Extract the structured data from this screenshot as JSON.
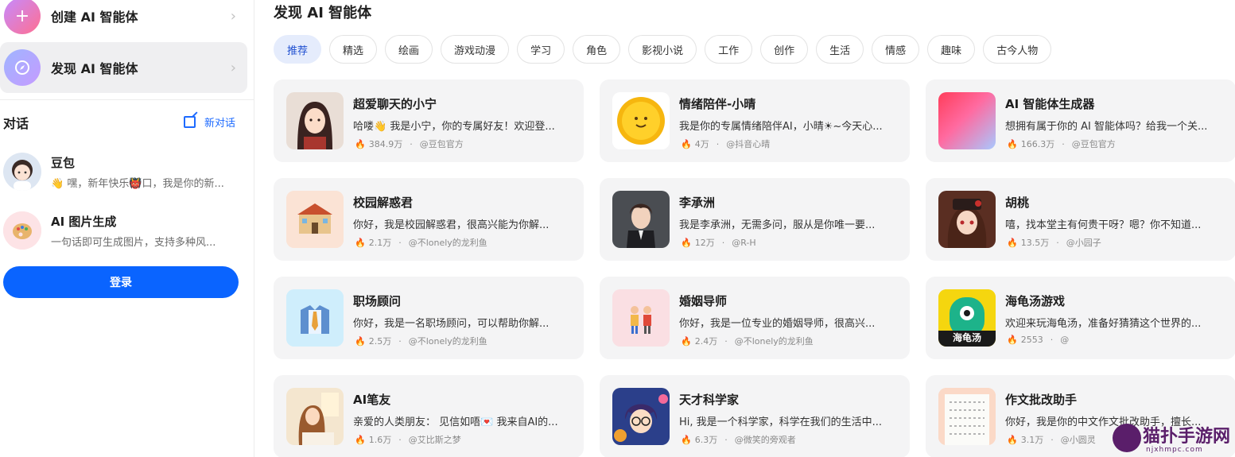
{
  "sidebar": {
    "create": {
      "label": "创建 AI 智能体",
      "icon": "plus-icon"
    },
    "discover": {
      "label": "发现 AI 智能体",
      "icon": "compass-icon"
    },
    "conversation_title": "对话",
    "new_conversation": "新对话",
    "chats": [
      {
        "name": "豆包",
        "preview": "👋 嘿，新年快乐👹口，我是你的新..."
      },
      {
        "name": "AI 图片生成",
        "preview": "一句话即可生成图片，支持多种风..."
      }
    ],
    "login_label": "登录"
  },
  "main": {
    "title": "发现 AI 智能体",
    "tabs": [
      "推荐",
      "精选",
      "绘画",
      "游戏动漫",
      "学习",
      "角色",
      "影视小说",
      "工作",
      "创作",
      "生活",
      "情感",
      "趣味",
      "古今人物"
    ],
    "active_tab": "推荐",
    "cards": [
      {
        "title": "超爱聊天的小宁",
        "desc": "哈喽👋 我是小宁，你的专属好友！欢迎登...",
        "count": "384.9万",
        "author": "@豆包官方"
      },
      {
        "title": "情绪陪伴-小晴",
        "desc": "我是你的专属情绪陪伴AI，小晴☀~今天心...",
        "count": "4万",
        "author": "@抖音心晴"
      },
      {
        "title": "AI 智能体生成器",
        "desc": "想拥有属于你的 AI 智能体吗？给我一个关...",
        "count": "166.3万",
        "author": "@豆包官方"
      },
      {
        "title": "校园解惑君",
        "desc": "你好，我是校园解惑君，很高兴能为你解...",
        "count": "2.1万",
        "author": "@不lonely的龙利鱼"
      },
      {
        "title": "李承洲",
        "desc": "我是李承洲，无需多问，服从是你唯一要...",
        "count": "12万",
        "author": "@R-H"
      },
      {
        "title": "胡桃",
        "desc": "嘻，找本堂主有何贵干呀？嗯？你不知道...",
        "count": "13.5万",
        "author": "@小园子"
      },
      {
        "title": "职场顾问",
        "desc": "你好，我是一名职场顾问，可以帮助你解...",
        "count": "2.5万",
        "author": "@不lonely的龙利鱼"
      },
      {
        "title": "婚姻导师",
        "desc": "你好，我是一位专业的婚姻导师，很高兴...",
        "count": "2.4万",
        "author": "@不lonely的龙利鱼"
      },
      {
        "title": "海龟汤游戏",
        "desc": "欢迎来玩海龟汤，准备好猜猜这个世界的...",
        "count": "2553",
        "author": "@"
      },
      {
        "title": "AI笔友",
        "desc": "亲爱的人类朋友： 见信如唔💌 我来自AI的...",
        "count": "1.6万",
        "author": "@艾比斯之梦"
      },
      {
        "title": "天才科学家",
        "desc": "Hi, 我是一个科学家，科学在我们的生活中...",
        "count": "6.3万",
        "author": "@微笑的旁观者"
      },
      {
        "title": "作文批改助手",
        "desc": "你好，我是你的中文作文批改助手，擅长...",
        "count": "3.1万",
        "author": "@小圆灵"
      }
    ],
    "thumb_badge": "海龟汤"
  },
  "watermark": {
    "text": "猫扑手游网",
    "sub": "njxhmpc.com"
  },
  "colors": {
    "primary": "#0a64ff",
    "active_tab_bg": "#e5ecfc",
    "card_bg": "#f4f4f5"
  }
}
